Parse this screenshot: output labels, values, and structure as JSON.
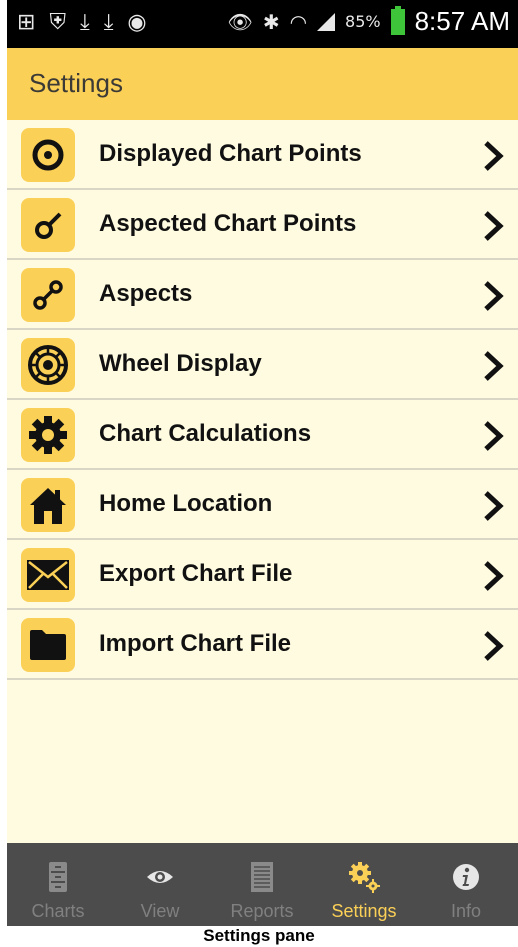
{
  "status_bar": {
    "battery": "85%",
    "time": "8:57 AM",
    "left_icons": [
      "plus-square-icon",
      "shield-icon",
      "download-icon",
      "download-icon",
      "chrome-icon"
    ],
    "right_icons": [
      "eye-icon",
      "bluetooth-icon",
      "wifi-icon",
      "signal-icon",
      "battery-icon"
    ]
  },
  "header": {
    "title": "Settings"
  },
  "menu": {
    "items": [
      {
        "label": "Displayed Chart Points",
        "icon": "target-icon"
      },
      {
        "label": "Aspected Chart Points",
        "icon": "aspect-point-icon"
      },
      {
        "label": "Aspects",
        "icon": "aspects-icon"
      },
      {
        "label": "Wheel Display",
        "icon": "wheel-icon"
      },
      {
        "label": "Chart Calculations",
        "icon": "gear-icon"
      },
      {
        "label": "Home Location",
        "icon": "home-icon"
      },
      {
        "label": "Export Chart File",
        "icon": "envelope-icon"
      },
      {
        "label": "Import Chart File",
        "icon": "folder-icon"
      }
    ]
  },
  "tab_bar": {
    "tabs": [
      {
        "label": "Charts",
        "icon": "cabinet-icon",
        "active": false
      },
      {
        "label": "View",
        "icon": "eye-icon",
        "active": false
      },
      {
        "label": "Reports",
        "icon": "document-icon",
        "active": false
      },
      {
        "label": "Settings",
        "icon": "gears-icon",
        "active": true
      },
      {
        "label": "Info",
        "icon": "info-icon",
        "active": false
      }
    ]
  },
  "caption": "Settings pane",
  "colors": {
    "accent": "#fbd057",
    "background": "#fffbe1",
    "tabbar": "#4c4c4c",
    "active_tab": "#fbd057"
  }
}
